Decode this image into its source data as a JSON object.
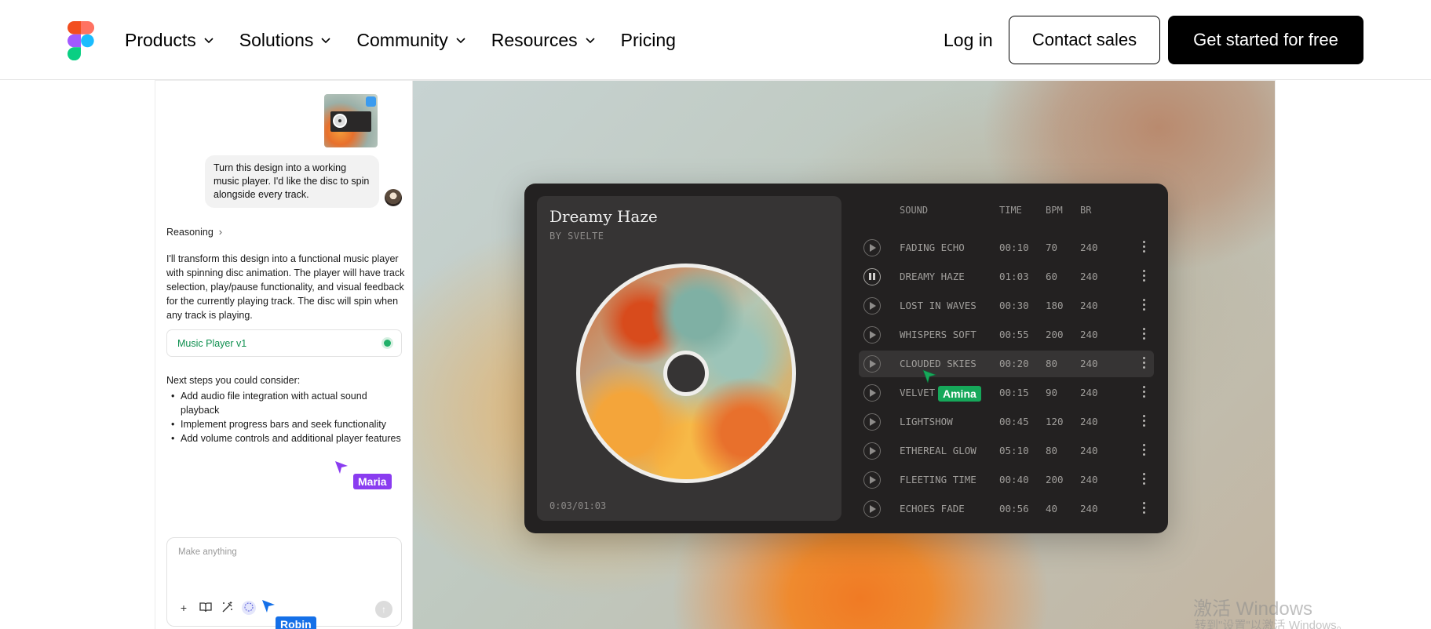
{
  "nav": {
    "items": [
      {
        "label": "Products",
        "has_menu": true
      },
      {
        "label": "Solutions",
        "has_menu": true
      },
      {
        "label": "Community",
        "has_menu": true
      },
      {
        "label": "Resources",
        "has_menu": true
      },
      {
        "label": "Pricing",
        "has_menu": false
      }
    ],
    "login": "Log in",
    "contact_sales": "Contact sales",
    "get_started": "Get started for free"
  },
  "chat": {
    "user_message": "Turn this design into a working music player. I'd like the disc to spin alongside every track.",
    "reasoning_label": "Reasoning",
    "reply": "I'll transform this design into a functional music player with spinning disc animation. The player will have track selection, play/pause functionality, and visual feedback for the currently playing track. The disc will spin when any track is playing.",
    "file_card": "Music Player v1",
    "next_title": "Next steps you could consider:",
    "next_steps": [
      "Add audio file integration with actual sound playback",
      "Implement progress bars and seek functionality",
      "Add volume controls and additional player features"
    ],
    "composer_placeholder": "Make anything"
  },
  "cursors": [
    {
      "name": "Maria",
      "color": "#8a3cf0"
    },
    {
      "name": "Amina",
      "color": "#16a85a"
    },
    {
      "name": "Robin",
      "color": "#1570e8"
    }
  ],
  "player": {
    "now_playing": {
      "title": "Dreamy Haze",
      "artist": "BY SVELTE",
      "time": "0:03/01:03"
    },
    "columns": {
      "sound": "SOUND",
      "time": "TIME",
      "bpm": "BPM",
      "br": "BR"
    },
    "tracks": [
      {
        "sound": "FADING ECHO",
        "time": "00:10",
        "bpm": "70",
        "br": "240",
        "state": "play"
      },
      {
        "sound": "DREAMY HAZE",
        "time": "01:03",
        "bpm": "60",
        "br": "240",
        "state": "pause"
      },
      {
        "sound": "LOST IN WAVES",
        "time": "00:30",
        "bpm": "180",
        "br": "240",
        "state": "play"
      },
      {
        "sound": "WHISPERS SOFT",
        "time": "00:55",
        "bpm": "200",
        "br": "240",
        "state": "play"
      },
      {
        "sound": "CLOUDED SKIES",
        "time": "00:20",
        "bpm": "80",
        "br": "240",
        "state": "play",
        "hover": true
      },
      {
        "sound": "VELVET",
        "time": "00:15",
        "bpm": "90",
        "br": "240",
        "state": "play"
      },
      {
        "sound": "LIGHTSHOW",
        "time": "00:45",
        "bpm": "120",
        "br": "240",
        "state": "play"
      },
      {
        "sound": "ETHEREAL GLOW",
        "time": "05:10",
        "bpm": "80",
        "br": "240",
        "state": "play"
      },
      {
        "sound": "FLEETING TIME",
        "time": "00:40",
        "bpm": "200",
        "br": "240",
        "state": "play"
      },
      {
        "sound": "ECHOES FADE",
        "time": "00:56",
        "bpm": "40",
        "br": "240",
        "state": "play"
      }
    ]
  },
  "watermark": {
    "line1": "激活 Windows",
    "line2": "转到\"设置\"以激活 Windows。"
  },
  "icons": {
    "logo": "figma-logo-icon",
    "chevron": "chevron-down-icon"
  }
}
